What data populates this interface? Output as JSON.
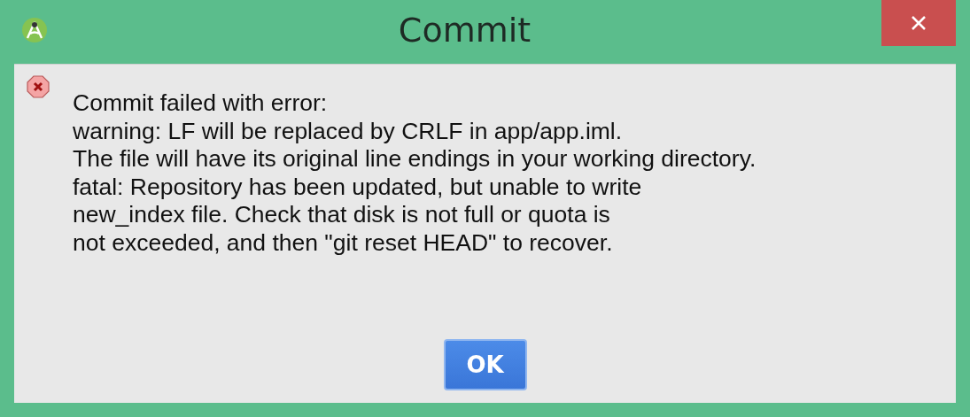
{
  "window": {
    "title": "Commit"
  },
  "message": {
    "lines": [
      "Commit failed with error:",
      "warning: LF will be replaced by CRLF in app/app.iml.",
      "The file will have its original line endings in your working directory.",
      "fatal: Repository has been updated, but unable to write",
      "new_index file. Check that disk is not full or quota is",
      "not exceeded, and then \"git reset HEAD\" to recover."
    ]
  },
  "buttons": [
    {
      "label": "OK",
      "selected": true
    }
  ]
}
